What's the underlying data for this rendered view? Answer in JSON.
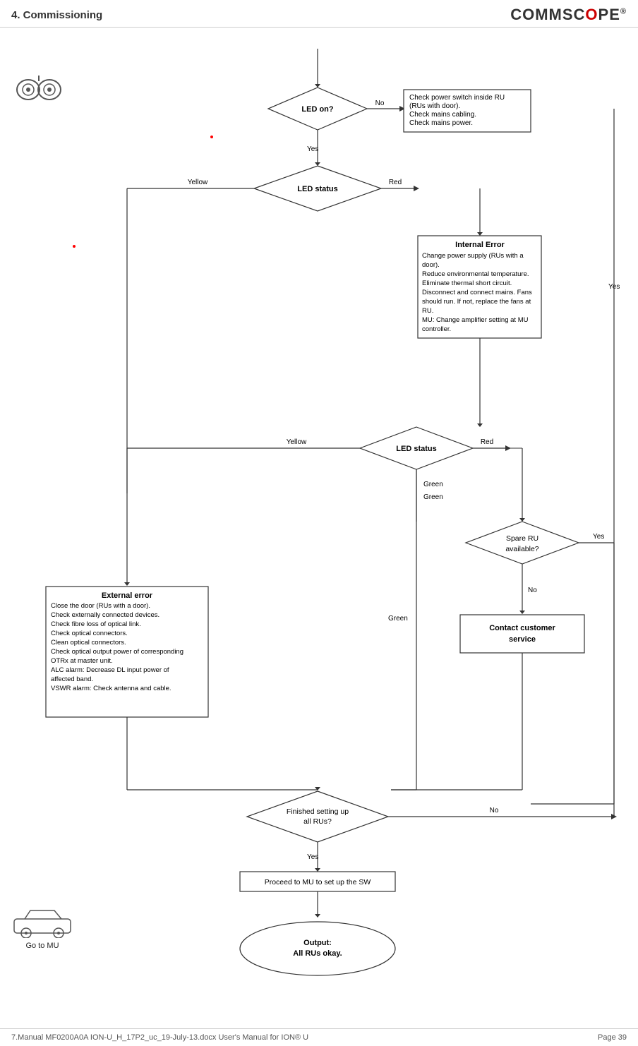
{
  "header": {
    "title": "4.  Commissioning",
    "logo": "COMMSCOPE"
  },
  "footer": {
    "doc_ref": "7.Manual MF0200A0A ION-U_H_17P2_uc_19-July-13.docx   User's Manual for ION® U",
    "page": "Page 39"
  },
  "diagram": {
    "nodes": {
      "led_on_diamond": "LED on?",
      "check_power_box": "Check power switch inside RU\n(RUs with door).\nCheck mains cabling.\nCheck mains power.",
      "led_status_diamond1": "LED status",
      "internal_error_box_title": "Internal Error",
      "internal_error_box_body": "Change power supply (RUs with a door).\nReduce environmental temperature.\nEliminate thermal short circuit.\nDisconnect and connect mains. Fans should run. If not, replace the fans at RU.\nMU: Change amplifier setting at MU controller.",
      "led_status_diamond2": "LED status",
      "spare_ru_diamond": "Spare RU\navailable?",
      "contact_customer": "Contact customer\nservice",
      "external_error_box_title": "External error",
      "external_error_box_body": "Close the door (RUs with a door).\nCheck externally connected devices.\nCheck fibre loss of optical link.\nCheck optical connectors.\nClean optical connectors.\nCheck optical output power of corresponding OTRx at master unit.\nALC alarm: Decrease DL input power of affected band.\nVSWR alarm: Check antenna and cable.",
      "finished_diamond": "Finished setting up\nall RUs?",
      "proceed_box": "Proceed to MU to set up the SW",
      "output_box": "Output:\nAll RUs okay."
    },
    "labels": {
      "no1": "No",
      "yes1": "Yes",
      "red1": "Red",
      "yellow1": "Yellow",
      "yellow2": "Yellow",
      "red2": "Red",
      "green1": "Green",
      "green2": "Green",
      "no2": "No",
      "yes_right": "Yes",
      "no3": "No",
      "yes2": "Yes"
    }
  },
  "icons": {
    "eye": "👁",
    "car_label": "Go to MU"
  }
}
